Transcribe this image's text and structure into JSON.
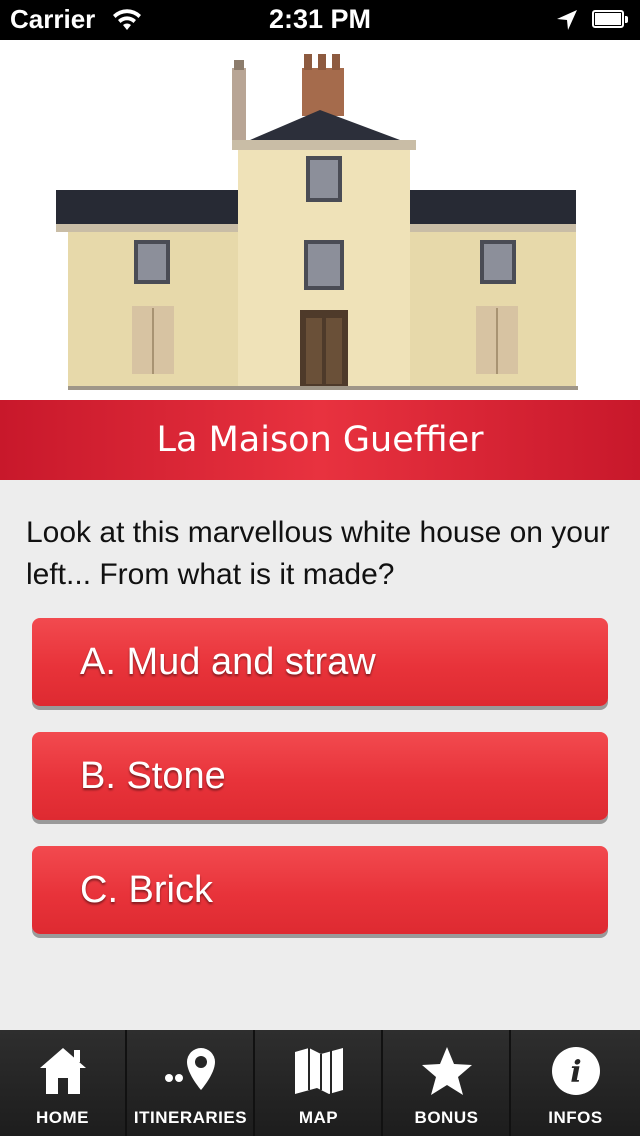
{
  "status_bar": {
    "carrier": "Carrier",
    "time": "2:31 PM"
  },
  "header": {
    "image_name": "house-illustration",
    "title": "La Maison Gueffier"
  },
  "quiz": {
    "question": "Look at this marvellous white house on your left... From what is it made?",
    "answers": [
      {
        "label": "A. Mud and straw"
      },
      {
        "label": "B. Stone"
      },
      {
        "label": "C. Brick"
      }
    ]
  },
  "tabs": [
    {
      "label": "HOME",
      "icon": "home-icon"
    },
    {
      "label": "ITINERARIES",
      "icon": "itineraries-icon"
    },
    {
      "label": "MAP",
      "icon": "map-icon"
    },
    {
      "label": "BONUS",
      "icon": "star-icon"
    },
    {
      "label": "INFOS",
      "icon": "info-icon"
    }
  ],
  "colors": {
    "accent_red": "#e8333a",
    "tabbar": "#222222"
  }
}
